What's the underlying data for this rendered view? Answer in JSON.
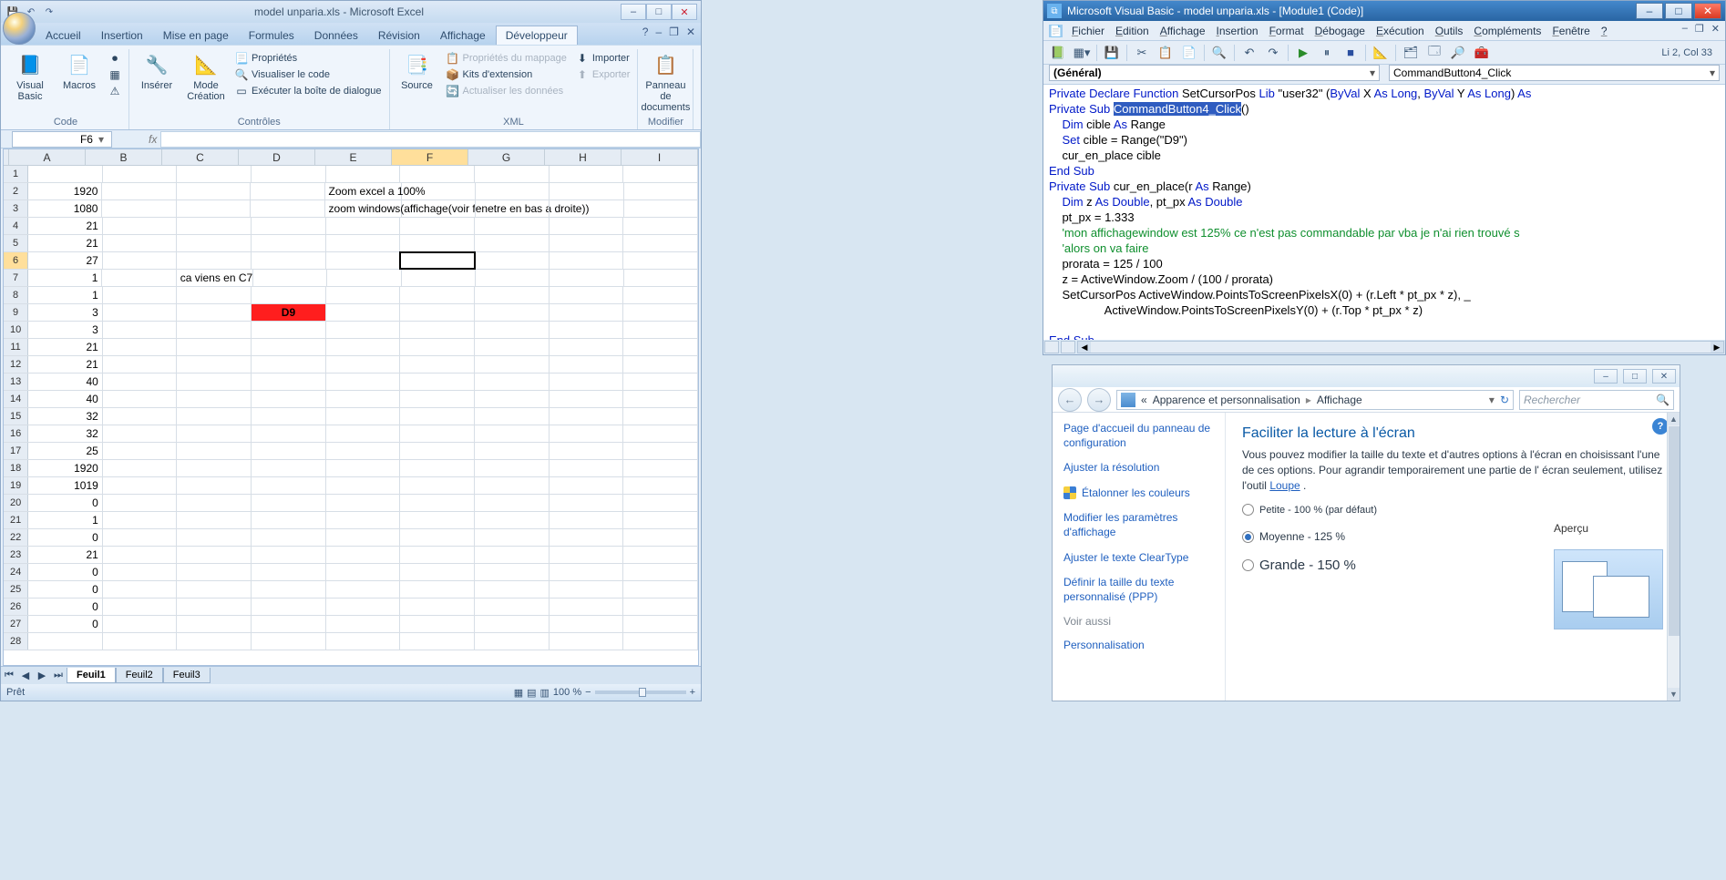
{
  "excel": {
    "title": "model unparia.xls - Microsoft Excel",
    "win_controls": {
      "min": "–",
      "max": "□",
      "close": "✕"
    },
    "doc_controls": {
      "help": "?",
      "min": "–",
      "restore": "❐",
      "close": "✕"
    },
    "tabs": [
      "Accueil",
      "Insertion",
      "Mise en page",
      "Formules",
      "Données",
      "Révision",
      "Affichage",
      "Développeur"
    ],
    "active_tab_index": 7,
    "ribbon": {
      "code": {
        "label": "Code",
        "visual_basic": "Visual\nBasic",
        "macros": "Macros",
        "rec": "",
        "rel": "",
        "sec": ""
      },
      "controles": {
        "label": "Contrôles",
        "inserer": "Insérer",
        "mode": "Mode\nCréation",
        "props": "Propriétés",
        "view_code": "Visualiser le code",
        "dialog": "Exécuter la boîte de dialogue"
      },
      "xml": {
        "label": "XML",
        "source": "Source",
        "map_props": "Propriétés du mappage",
        "kits": "Kits d'extension",
        "refresh": "Actualiser les données",
        "import": "Importer",
        "export": "Exporter"
      },
      "modifier": {
        "label": "Modifier",
        "panel": "Panneau de\ndocuments"
      }
    },
    "namebox": "F6",
    "fx": "fx",
    "columns": [
      "A",
      "B",
      "C",
      "D",
      "E",
      "F",
      "G",
      "H",
      "I"
    ],
    "selected_col_index": 5,
    "selected_row_index": 5,
    "rows": [
      {
        "n": 1,
        "A": "",
        "B": "",
        "C": "",
        "D": "",
        "E": "",
        "F": "",
        "G": "",
        "H": "",
        "I": ""
      },
      {
        "n": 2,
        "A": "1920",
        "E_txt": "Zoom excel a 100%"
      },
      {
        "n": 3,
        "A": "1080",
        "E_txt": "zoom windows(affichage(voir fenetre en bas a droite))"
      },
      {
        "n": 4,
        "A": "21"
      },
      {
        "n": 5,
        "A": "21"
      },
      {
        "n": 6,
        "A": "27"
      },
      {
        "n": 7,
        "A": "1",
        "C_txt": "ca viens en C7"
      },
      {
        "n": 8,
        "A": "1"
      },
      {
        "n": 9,
        "A": "3",
        "D_red": "D9"
      },
      {
        "n": 10,
        "A": "3"
      },
      {
        "n": 11,
        "A": "21"
      },
      {
        "n": 12,
        "A": "21"
      },
      {
        "n": 13,
        "A": "40"
      },
      {
        "n": 14,
        "A": "40"
      },
      {
        "n": 15,
        "A": "32"
      },
      {
        "n": 16,
        "A": "32"
      },
      {
        "n": 17,
        "A": "25"
      },
      {
        "n": 18,
        "A": "1920"
      },
      {
        "n": 19,
        "A": "1019"
      },
      {
        "n": 20,
        "A": "0"
      },
      {
        "n": 21,
        "A": "1"
      },
      {
        "n": 22,
        "A": "0"
      },
      {
        "n": 23,
        "A": "21"
      },
      {
        "n": 24,
        "A": "0"
      },
      {
        "n": 25,
        "A": "0"
      },
      {
        "n": 26,
        "A": "0"
      },
      {
        "n": 27,
        "A": "0"
      },
      {
        "n": 28,
        "A": ""
      }
    ],
    "sheets": [
      "Feuil1",
      "Feuil2",
      "Feuil3"
    ],
    "active_sheet": 0,
    "status": "Prêt",
    "zoom": "100 %"
  },
  "vbe": {
    "title": "Microsoft Visual Basic - model unparia.xls - [Module1 (Code)]",
    "menus": [
      "Fichier",
      "Edition",
      "Affichage",
      "Insertion",
      "Format",
      "Débogage",
      "Exécution",
      "Outils",
      "Compléments",
      "Fenêtre",
      "?"
    ],
    "cursor_pos": "Li 2, Col 33",
    "combo_left": "(Général)",
    "combo_right": "CommandButton4_Click",
    "code": {
      "l1a": "Private Declare Function",
      "l1b": " SetCursorPos ",
      "l1c": "Lib",
      "l1d": " \"user32\" (",
      "l1e": "ByVal",
      "l1f": " X ",
      "l1g": "As Long",
      "l1h": ", ",
      "l1i": "ByVal",
      "l1j": " Y ",
      "l1k": "As Long",
      "l1l": ") ",
      "l1m": "As",
      "l2a": "Private Sub ",
      "l2sel": "CommandButton4_Click",
      "l2c": "()",
      "l3a": "    Dim",
      "l3b": " cible ",
      "l3c": "As",
      "l3d": " Range",
      "l4a": "    Set",
      "l4b": " cible = Range(\"D9\")",
      "l5": "    cur_en_place cible",
      "l6": "End Sub",
      "l7a": "Private Sub",
      "l7b": " cur_en_place(r ",
      "l7c": "As",
      "l7d": " Range)",
      "l8a": "    Dim",
      "l8b": " z ",
      "l8c": "As Double",
      "l8d": ", pt_px ",
      "l8e": "As Double",
      "l9": "    pt_px = 1.333",
      "l10": "    'mon affichagewindow est 125% ce n'est pas commandable par vba je n'ai rien trouvé s",
      "l11": "    'alors on va faire",
      "l12": "    prorata = 125 / 100",
      "l13": "    z = ActiveWindow.Zoom / (100 / prorata)",
      "l14": "    SetCursorPos ActiveWindow.PointsToScreenPixelsX(0) + (r.Left * pt_px * z), _",
      "l15": "                 ActiveWindow.PointsToScreenPixelsY(0) + (r.Top * pt_px * z)",
      "l16": "End Sub"
    }
  },
  "cp": {
    "breadcrumb_back": "«",
    "breadcrumb1": "Apparence et personnalisation",
    "breadcrumb2": "Affichage",
    "search_placeholder": "Rechercher",
    "side": {
      "home": "Page d'accueil du panneau de configuration",
      "adjust_res": "Ajuster la résolution",
      "calibrate": "Étalonner les couleurs",
      "disp_params": "Modifier les paramètres d'affichage",
      "cleartype": "Ajuster le texte ClearType",
      "custom_dpi": "Définir la taille du texte personnalisé (PPP)",
      "see_also": "Voir aussi",
      "personal": "Personnalisation"
    },
    "main": {
      "title": "Faciliter la lecture à l'écran",
      "desc_a": "Vous pouvez modifier la taille du texte et d'autres options à l'écran en choisissant l'une de ces options. Pour agrandir temporairement une partie de l' écran seulement, utilisez l'outil ",
      "desc_link": "Loupe",
      "desc_b": " .",
      "opt_small": "Petite - 100 % (par défaut)",
      "opt_medium": "Moyenne - 125 %",
      "opt_large": "Grande - 150 %",
      "apercu": "Aperçu"
    }
  }
}
